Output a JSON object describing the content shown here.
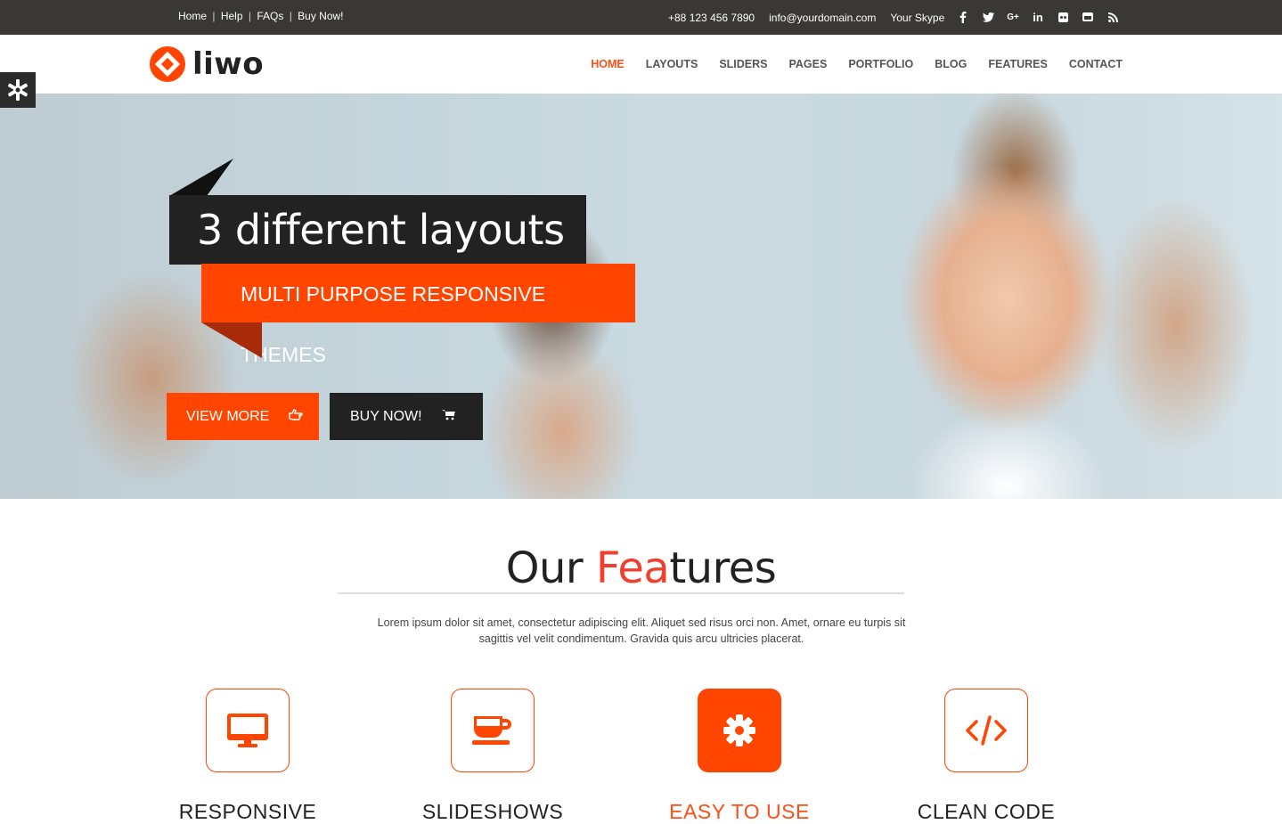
{
  "topbar": {
    "links": [
      "Home",
      "Help",
      "FAQs",
      "Buy Now!"
    ],
    "separator": "|",
    "phone": "+88 123 456 7890",
    "email": "info@yourdomain.com",
    "skype": "Your Skype",
    "social": [
      "f",
      "t",
      "G+",
      "in",
      "fl",
      "yt",
      "rss"
    ]
  },
  "header": {
    "logo_text": "liwo",
    "nav": [
      "HOME",
      "LAYOUTS",
      "SLIDERS",
      "PAGES",
      "PORTFOLIO",
      "BLOG",
      "FEATURES",
      "CONTACT"
    ],
    "active_nav": "HOME"
  },
  "hero": {
    "title": "3 different layouts",
    "subtitle": "MULTI PURPOSE RESPONSIVE THEMES",
    "btn_view": "VIEW MORE",
    "btn_buy": "BUY NOW!"
  },
  "features": {
    "title_a": "Our ",
    "title_hl": "Fea",
    "title_b": "tures",
    "description_line1": "Lorem ipsum dolor sit amet, consectetur adipiscing elit. Aliquet sed risus orci non. Amet, ornare eu turpis sit",
    "description_line2": "sagittis vel velit condimentum. Gravida quis arcu ultricies placerat.",
    "items": [
      {
        "label": "RESPONSIVE",
        "icon": "monitor-icon"
      },
      {
        "label": "SLIDESHOWS",
        "icon": "coffee-cup-icon"
      },
      {
        "label": "EASY TO USE",
        "icon": "gear-icon"
      },
      {
        "label": "CLEAN CODE",
        "icon": "code-icon"
      }
    ]
  },
  "colors": {
    "accent": "#ff4500",
    "dark": "#222222",
    "topbar": "#393834"
  }
}
